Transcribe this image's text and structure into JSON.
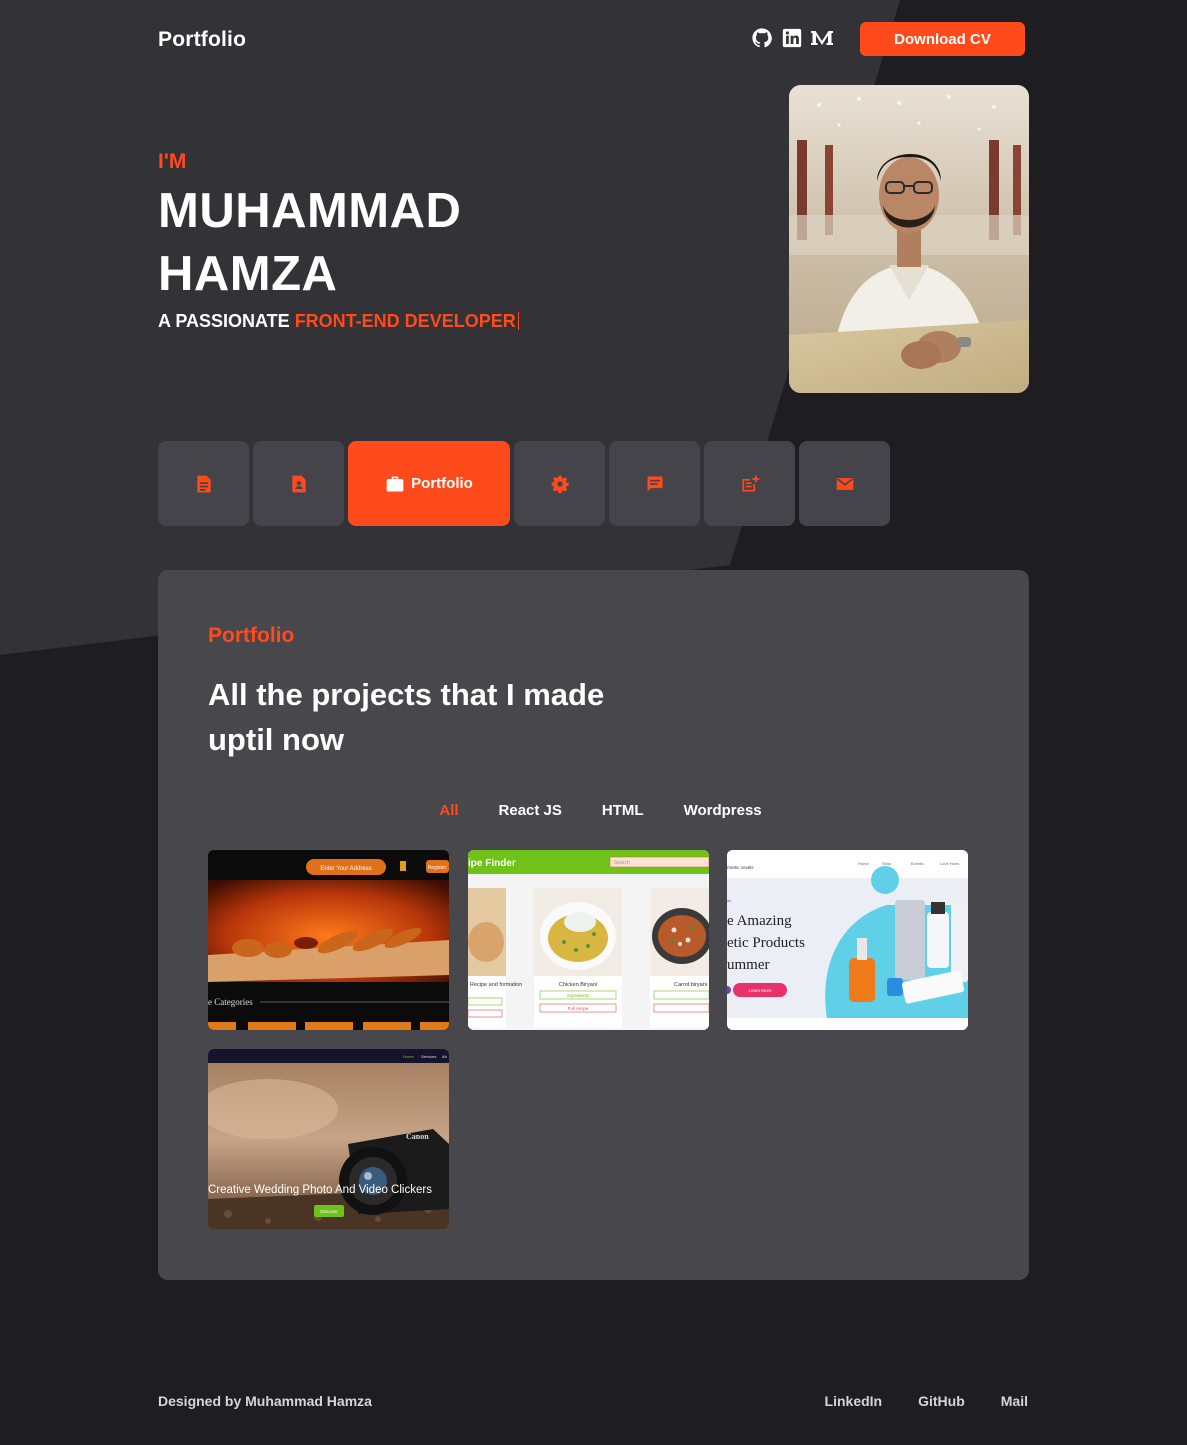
{
  "header": {
    "brand": "Portfolio",
    "social": [
      "github-icon",
      "linkedin-icon",
      "medium-icon"
    ],
    "cv_button": "Download CV"
  },
  "hero": {
    "intro": "I'M",
    "name_line1": "MUHAMMAD",
    "name_line2": "HAMZA",
    "tagline_prefix": "A PASSIONATE ",
    "tagline_accent": "FRONT-END DEVELOPER"
  },
  "nav": {
    "items": [
      {
        "icon": "document-icon",
        "label": ""
      },
      {
        "icon": "contact-card-icon",
        "label": ""
      },
      {
        "icon": "briefcase-icon",
        "label": "Portfolio",
        "active": true
      },
      {
        "icon": "gear-icon",
        "label": ""
      },
      {
        "icon": "chat-icon",
        "label": ""
      },
      {
        "icon": "post-add-icon",
        "label": ""
      },
      {
        "icon": "mail-icon",
        "label": ""
      }
    ]
  },
  "portfolio": {
    "section_label": "Portfolio",
    "title": "All the projects that I made uptil now",
    "filters": [
      "All",
      "React JS",
      "HTML",
      "Wordpress"
    ],
    "active_filter": "All",
    "projects": [
      {
        "name": "food-delivery",
        "texts": {
          "address": "Enter Your Address",
          "register": "Register",
          "categories": "e Categories"
        }
      },
      {
        "name": "recipe-finder",
        "texts": {
          "title": "ipe Finder",
          "search": "Search",
          "item1": "Recipe and formation",
          "item2": "Chicken Biryani",
          "item3": "Carrot biryani",
          "btn1": "ingredients",
          "btn2": "Full recipe"
        }
      },
      {
        "name": "cosmetics",
        "texts": {
          "brand": "rmetic novels",
          "menu": [
            "Home",
            "Shop",
            "Eventd",
            "Love Hons"
          ],
          "line1": "e Amazing",
          "line2": "etic Products",
          "line3": "ummer",
          "cta": "Learn More"
        }
      },
      {
        "name": "wedding-photo",
        "texts": {
          "nav": [
            "Home",
            "Services",
            "Ab"
          ],
          "headline": "Creative Wedding Photo And Video Clickers",
          "cta": "Discover"
        }
      }
    ]
  },
  "footer": {
    "credit": "Designed by Muhammad Hamza",
    "links": [
      "LinkedIn",
      "GitHub",
      "Mail"
    ]
  },
  "colors": {
    "accent": "#ff4a1c",
    "page_bg": "#1e1d21",
    "hero_panel": "#323237",
    "card_bg": "#47474c"
  }
}
